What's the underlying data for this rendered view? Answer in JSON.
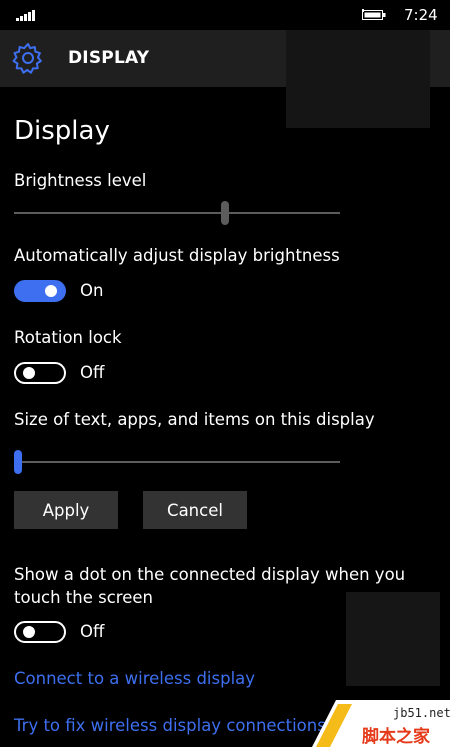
{
  "status_bar": {
    "time": "7:24",
    "icons": [
      "signal-icon",
      "battery-charging-icon"
    ]
  },
  "header": {
    "icon": "gear-icon",
    "title": "DISPLAY"
  },
  "page": {
    "title": "Display",
    "brightness": {
      "label": "Brightness level",
      "value": 0.65
    },
    "auto_brightness": {
      "label": "Automatically adjust display brightness",
      "state": "On"
    },
    "rotation_lock": {
      "label": "Rotation lock",
      "state": "Off"
    },
    "text_size": {
      "label": "Size of text, apps, and items on this display",
      "value": 0.0
    },
    "buttons": {
      "apply": "Apply",
      "cancel": "Cancel"
    },
    "touch_dot": {
      "label_line1": "Show a dot on the connected display when you",
      "label_line2": "touch the screen",
      "state": "Off"
    },
    "links": {
      "connect": "Connect to a wireless display",
      "fix": "Try to fix wireless display connections"
    }
  },
  "watermark": {
    "site": "jb51.net",
    "name": "脚本之家"
  },
  "colors": {
    "accent": "#3d6ff0",
    "background": "#000000",
    "header_background": "#1f1f1f",
    "button_background": "#333333"
  }
}
